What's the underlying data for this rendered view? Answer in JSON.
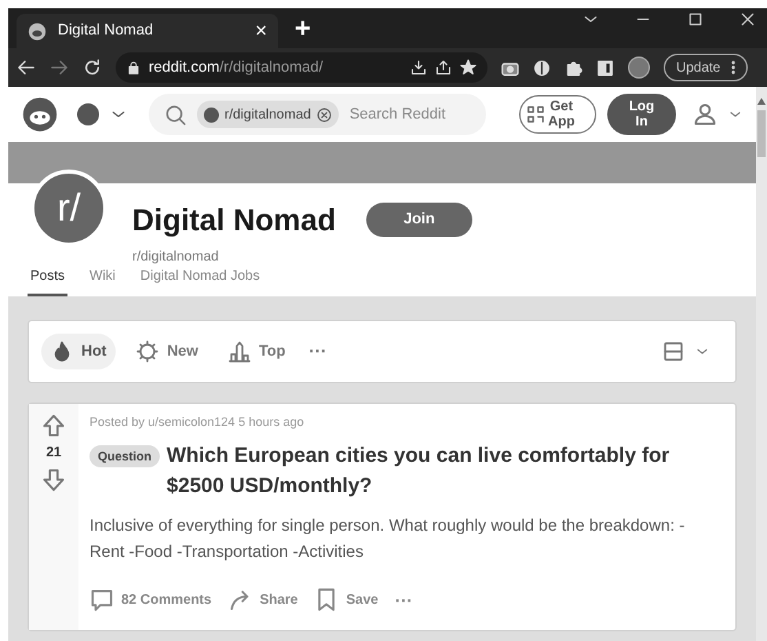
{
  "browser": {
    "tab_title": "Digital Nomad",
    "tab_close": "×",
    "new_tab": "+",
    "url_host": "reddit.com",
    "url_path": "/r/digitalnomad/",
    "update": "Update"
  },
  "header": {
    "search_chip": "r/digitalnomad",
    "search_placeholder": "Search Reddit",
    "get_app": [
      "Get",
      "App"
    ],
    "login": [
      "Log",
      "In"
    ]
  },
  "community": {
    "avatar": "r/",
    "name": "Digital Nomad",
    "handle": "r/digitalnomad",
    "join": "Join",
    "tabs": [
      {
        "label": "Posts",
        "selected": true
      },
      {
        "label": "Wiki",
        "selected": false
      },
      {
        "label": "Digital Nomad Jobs",
        "selected": false
      }
    ]
  },
  "sort": {
    "options": [
      {
        "kind": "hot",
        "label": "Hot",
        "selected": true
      },
      {
        "kind": "new",
        "label": "New",
        "selected": false
      },
      {
        "kind": "top",
        "label": "Top",
        "selected": false
      }
    ],
    "more": "···"
  },
  "post": {
    "byline": "Posted by u/semicolon124 5 hours ago",
    "votes": "21",
    "flair": "Question",
    "title": "Which European cities you can live comfortably for $2500 USD/monthly?",
    "body": "Inclusive of everything for single person. What roughly would be the breakdown: -Rent -Food -Transportation -Activities",
    "actions": [
      {
        "kind": "comments",
        "label": "82 Comments"
      },
      {
        "kind": "share",
        "label": "Share"
      },
      {
        "kind": "save",
        "label": "Save"
      }
    ],
    "more": "···"
  }
}
